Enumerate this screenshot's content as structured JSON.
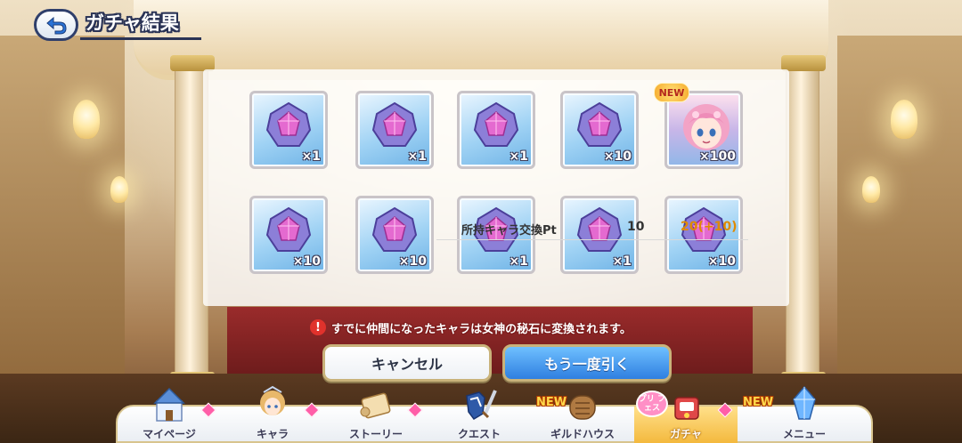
{
  "header": {
    "title": "ガチャ結果"
  },
  "results": [
    {
      "type": "stone",
      "qty": "×1"
    },
    {
      "type": "stone",
      "qty": "×1"
    },
    {
      "type": "stone",
      "qty": "×1"
    },
    {
      "type": "stone",
      "qty": "×10"
    },
    {
      "type": "character",
      "qty": "×100",
      "badge": "NEW"
    },
    {
      "type": "stone",
      "qty": "×10"
    },
    {
      "type": "stone",
      "qty": "×10"
    },
    {
      "type": "stone",
      "qty": "×1"
    },
    {
      "type": "stone",
      "qty": "×1"
    },
    {
      "type": "stone",
      "qty": "×10"
    }
  ],
  "exchange_points": {
    "label": "所持キャラ交換Pt",
    "before": "10",
    "after": "20(+10)"
  },
  "notice": {
    "icon": "!",
    "text": "すでに仲間になったキャラは女神の秘石に変換されます。"
  },
  "buttons": {
    "cancel": "キャンセル",
    "draw_again": "もう一度引く"
  },
  "nav": {
    "items": [
      {
        "label": "マイページ",
        "icon": "castle-icon",
        "diamond": true
      },
      {
        "label": "キャラ",
        "icon": "character-icon",
        "diamond": true
      },
      {
        "label": "ストーリー",
        "icon": "scroll-icon",
        "diamond": true
      },
      {
        "label": "クエスト",
        "icon": "sword-shield-icon",
        "diamond": false
      },
      {
        "label": "ギルドハウス",
        "icon": "house-icon",
        "new": "NEW"
      },
      {
        "label": "ガチャ",
        "icon": "gacha-icon",
        "active": true,
        "pri": "プリ\nフェス",
        "diamond": true
      },
      {
        "label": "メニュー",
        "icon": "crystal-icon",
        "new": "NEW"
      }
    ]
  },
  "colors": {
    "accent_blue": "#2f7fe0",
    "point_gain": "#e08a00",
    "warning_red": "#e0322c"
  }
}
